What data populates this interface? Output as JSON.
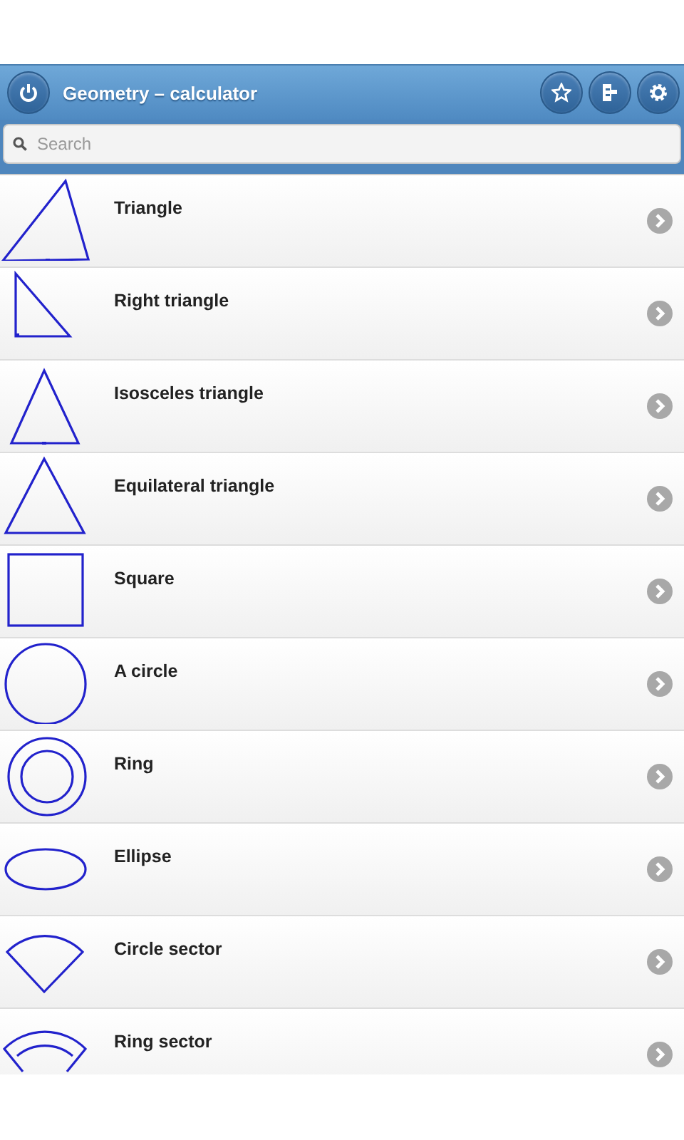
{
  "header": {
    "title": "Geometry – calculator"
  },
  "search": {
    "placeholder": "Search"
  },
  "shapes": [
    {
      "kind": "triangle",
      "label": "Triangle"
    },
    {
      "kind": "right",
      "label": "Right triangle"
    },
    {
      "kind": "isosceles",
      "label": "Isosceles triangle"
    },
    {
      "kind": "equilateral",
      "label": "Equilateral triangle"
    },
    {
      "kind": "square",
      "label": "Square"
    },
    {
      "kind": "circle",
      "label": "A circle"
    },
    {
      "kind": "ring",
      "label": "Ring"
    },
    {
      "kind": "ellipse",
      "label": "Ellipse"
    },
    {
      "kind": "sector",
      "label": "Circle sector"
    },
    {
      "kind": "ringsector",
      "label": "Ring sector"
    }
  ]
}
